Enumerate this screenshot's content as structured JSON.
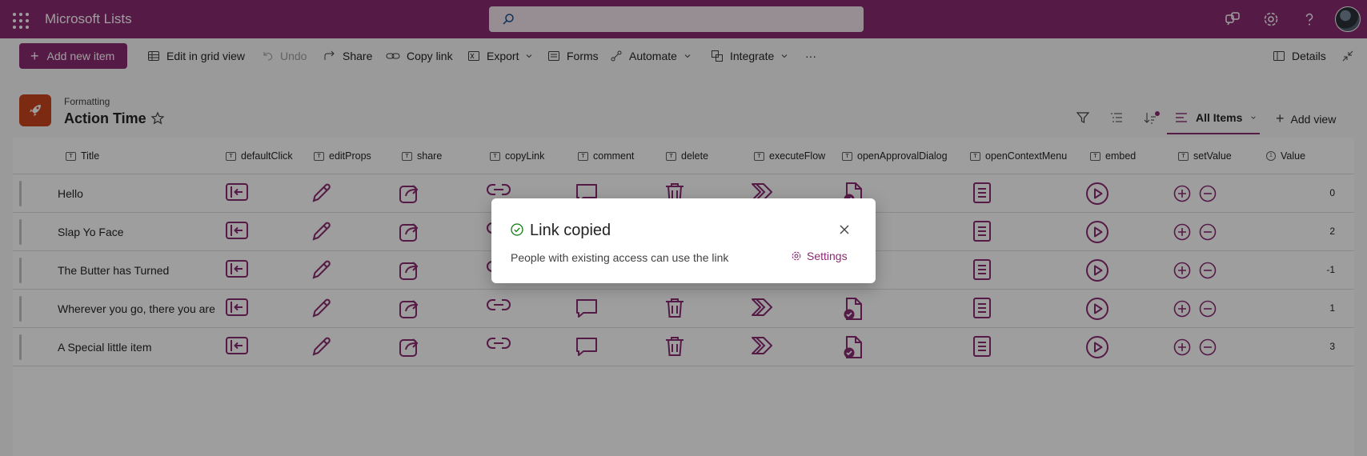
{
  "app": {
    "name": "Microsoft Lists"
  },
  "search": {
    "placeholder": ""
  },
  "toolbar": {
    "add_new_item": "Add new item",
    "edit_grid": "Edit in grid view",
    "undo": "Undo",
    "share": "Share",
    "copy_link": "Copy link",
    "export": "Export",
    "forms": "Forms",
    "automate": "Automate",
    "integrate": "Integrate",
    "more": "···",
    "details": "Details"
  },
  "header": {
    "breadcrumb": "Formatting",
    "title": "Action Time"
  },
  "views": {
    "current": "All Items",
    "add_view": "Add view"
  },
  "columns": [
    "Title",
    "defaultClick",
    "editProps",
    "share",
    "copyLink",
    "comment",
    "delete",
    "executeFlow",
    "openApprovalDialog",
    "openContextMenu",
    "embed",
    "setValue",
    "Value"
  ],
  "rows": [
    {
      "title": "Hello",
      "value": "0"
    },
    {
      "title": "Slap Yo Face",
      "value": "2"
    },
    {
      "title": "The Butter has Turned",
      "value": "-1"
    },
    {
      "title": "Wherever you go, there you are",
      "value": "1"
    },
    {
      "title": "A Special little item",
      "value": "3"
    }
  ],
  "dialog": {
    "title": "Link copied",
    "message": "People with existing access can use the link",
    "settings": "Settings"
  },
  "colors": {
    "brand": "#8b2a73",
    "list_icon": "#c8451e",
    "success": "#107c10"
  }
}
